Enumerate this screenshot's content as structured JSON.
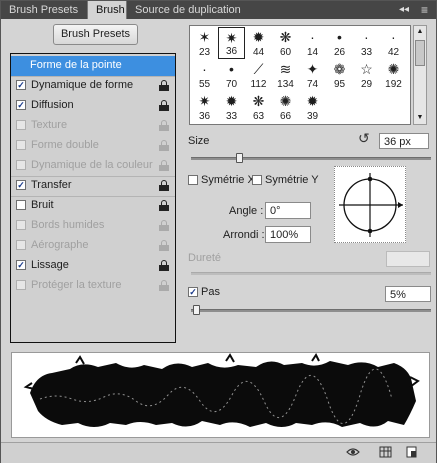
{
  "tabs": [
    {
      "label": "Brush Presets"
    },
    {
      "label": "Brush"
    },
    {
      "label": "Source de duplication"
    }
  ],
  "tab_controls": {
    "collapse": "◂◂",
    "menu": "≡"
  },
  "presets_button": "Brush Presets",
  "options": [
    {
      "label": "Forme de la pointe",
      "selected": true,
      "checkable": false,
      "checked": false,
      "disabled": false,
      "lock": false
    },
    {
      "label": "Dynamique de forme",
      "checkable": true,
      "checked": true,
      "disabled": false,
      "lock": true
    },
    {
      "label": "Diffusion",
      "checkable": true,
      "checked": true,
      "disabled": false,
      "lock": true
    },
    {
      "label": "Texture",
      "checkable": true,
      "checked": false,
      "disabled": true,
      "lock": true
    },
    {
      "label": "Forme double",
      "checkable": true,
      "checked": false,
      "disabled": true,
      "lock": true
    },
    {
      "label": "Dynamique de la couleur",
      "checkable": true,
      "checked": false,
      "disabled": true,
      "lock": true
    },
    {
      "label": "Transfer",
      "checkable": true,
      "checked": true,
      "disabled": false,
      "lock": true
    },
    {
      "label": "Bruit",
      "checkable": true,
      "checked": false,
      "disabled": false,
      "lock": true
    },
    {
      "label": "Bords humides",
      "checkable": true,
      "checked": false,
      "disabled": true,
      "lock": true
    },
    {
      "label": "Aérographe",
      "checkable": true,
      "checked": false,
      "disabled": true,
      "lock": true
    },
    {
      "label": "Lissage",
      "checkable": true,
      "checked": true,
      "disabled": false,
      "lock": true
    },
    {
      "label": "Protéger la texture",
      "checkable": true,
      "checked": false,
      "disabled": true,
      "lock": true
    }
  ],
  "brush_tips": [
    {
      "size": "23",
      "glyph": "✶"
    },
    {
      "size": "36",
      "glyph": "✷",
      "selected": true
    },
    {
      "size": "44",
      "glyph": "✹"
    },
    {
      "size": "60",
      "glyph": "❋"
    },
    {
      "size": "14",
      "glyph": "·"
    },
    {
      "size": "26",
      "glyph": "•"
    },
    {
      "size": "33",
      "glyph": "∙"
    },
    {
      "size": "42",
      "glyph": "∙"
    },
    {
      "size": "55",
      "glyph": "·"
    },
    {
      "size": "70",
      "glyph": "•"
    },
    {
      "size": "112",
      "glyph": "⟋"
    },
    {
      "size": "134",
      "glyph": "≋"
    },
    {
      "size": "74",
      "glyph": "✦"
    },
    {
      "size": "95",
      "glyph": "❁"
    },
    {
      "size": "29",
      "glyph": "☆"
    },
    {
      "size": "192",
      "glyph": "✺"
    },
    {
      "size": "36",
      "glyph": "✷"
    },
    {
      "size": "33",
      "glyph": "✹"
    },
    {
      "size": "63",
      "glyph": "❋"
    },
    {
      "size": "66",
      "glyph": "✺"
    },
    {
      "size": "39",
      "glyph": "✹"
    }
  ],
  "size": {
    "label": "Size",
    "value": "36 px",
    "slider_level": 0.2
  },
  "symmetry_x": {
    "label": "Symétrie X",
    "checked": false
  },
  "symmetry_y": {
    "label": "Symétrie Y",
    "checked": false
  },
  "angle": {
    "label": "Angle :",
    "value": "0°"
  },
  "roundness": {
    "label": "Arrondi :",
    "value": "100%"
  },
  "hardness": {
    "label": "Dureté",
    "value": ""
  },
  "spacing": {
    "label": "Pas",
    "checked": true,
    "value": "5%",
    "slider_level": 0.02
  },
  "colors": {
    "selected": "#3d8fe0",
    "tabbar": "#464646",
    "panel": "#d4d4d4"
  },
  "footer_icons": [
    "eye-icon",
    "grid-icon",
    "new-preset-icon"
  ]
}
